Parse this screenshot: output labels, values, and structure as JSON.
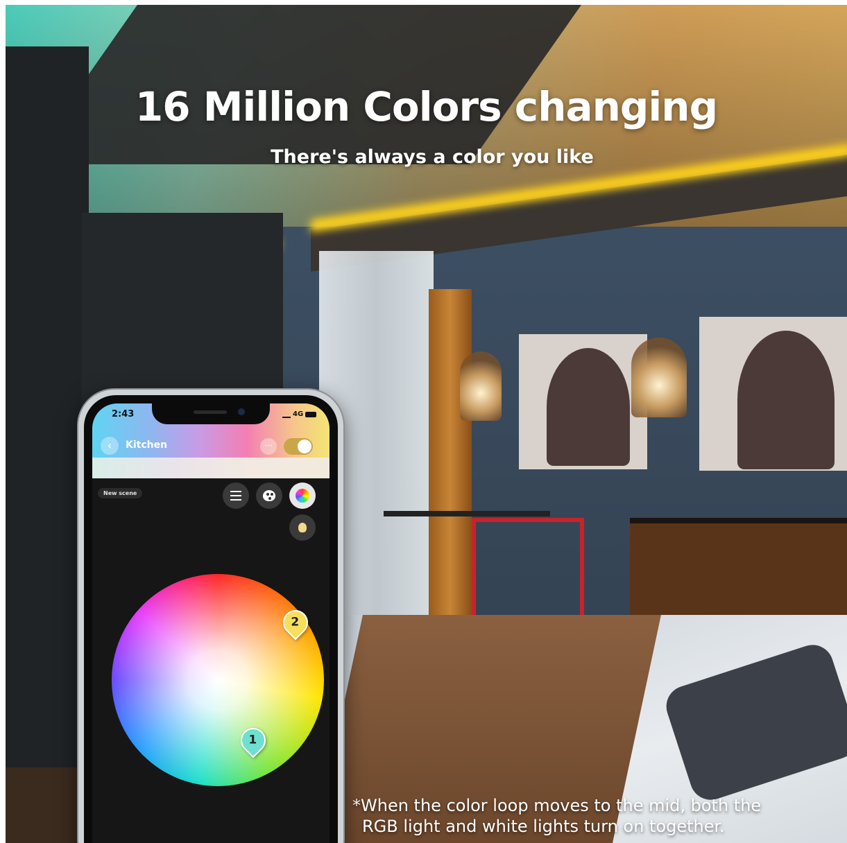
{
  "headline": "16 Million Colors changing",
  "subheadline": "There's always a color you like",
  "disclaimer": {
    "line1": "*When the color loop moves to the mid, both the",
    "line2": "RGB light and white lights turn on together."
  },
  "phone": {
    "status_time": "2:43",
    "network": "4G",
    "room_name": "Kitchen",
    "back_icon": "chevron-left-icon",
    "more_glyph": "···",
    "power_on": true,
    "new_scene_label": "New scene",
    "mode_icons": [
      "list-icon",
      "palette-icon",
      "color-wheel-icon",
      "bulb-icon"
    ],
    "pins": [
      "1",
      "2"
    ],
    "colors": {
      "toggle": "#c9a64a",
      "pin1": "#6fe0d0",
      "pin2": "#f6df5a"
    }
  }
}
